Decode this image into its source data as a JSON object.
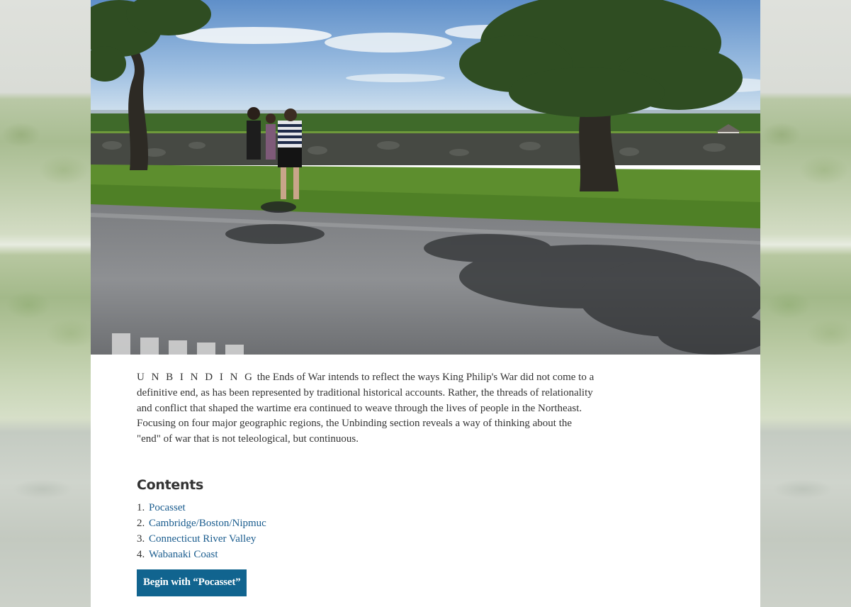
{
  "intro": {
    "smallcaps": "U N B I N D I N G",
    "text": " the Ends of War intends to reflect the ways King Philip's War did not come to a definitive end, as has been represented by traditional historical accounts. Rather, the threads of relationality and conflict that shaped the wartime era continued to weave through the lives of people in the Northeast. Focusing on four major geographic regions, the Unbinding section reveals a way of thinking about the \"end\" of war that is not teleological, but continuous."
  },
  "contents": {
    "heading": "Contents",
    "items": [
      {
        "num": "1.",
        "label": "Pocasset"
      },
      {
        "num": "2.",
        "label": "Cambridge/Boston/Nipmuc"
      },
      {
        "num": "3.",
        "label": "Connecticut River Valley"
      },
      {
        "num": "4.",
        "label": "Wabanaki Coast"
      }
    ]
  },
  "begin_button": {
    "label": "Begin with “Pocasset”"
  },
  "colors": {
    "link": "#1a5c8e",
    "button_bg": "#11648f",
    "text": "#333333"
  }
}
